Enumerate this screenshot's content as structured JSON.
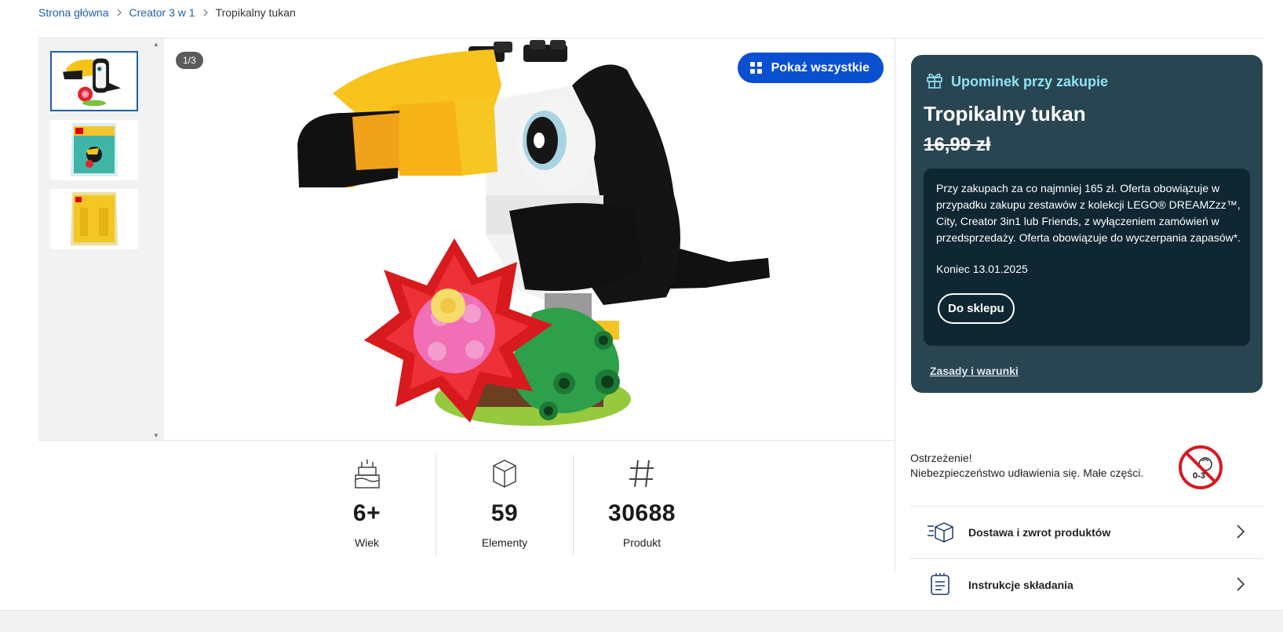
{
  "breadcrumb": {
    "home": "Strona główna",
    "category": "Creator 3 w 1",
    "current": "Tropikalny tukan"
  },
  "gallery": {
    "counter": "1/3",
    "show_all_label": "Pokaż wszystkie",
    "thumbnails": [
      "toucan-model",
      "polybag-front",
      "polybag-back"
    ],
    "selected_index": 0
  },
  "specs": [
    {
      "icon": "birthday-cake-icon",
      "value": "6+",
      "label": "Wiek"
    },
    {
      "icon": "brick-icon",
      "value": "59",
      "label": "Elementy"
    },
    {
      "icon": "hash-icon",
      "value": "30688",
      "label": "Produkt"
    }
  ],
  "promo": {
    "heading": "Upominek przy zakupie",
    "title": "Tropikalny tukan",
    "price": "16,99 zł",
    "description": "Przy zakupach za co najmniej 165 zł. Oferta obowiązuje w przypadku zakupu zestawów z kolekcji LEGO® DREAMZzz™, City, Creator 3in1 lub Friends, z wyłączeniem zamówień w przedsprzedaży. Oferta obowiązuje do wyczerpania zapasów*.",
    "end_date": "Koniec 13.01.2025",
    "button": "Do sklepu",
    "terms": "Zasady i warunki",
    "colors": {
      "card": "#2a4552",
      "inner": "#0f2733",
      "accent": "#8fe3f2"
    }
  },
  "warning": {
    "line1": "Ostrzeżenie!",
    "line2": "Niebezpieczeństwo udławienia się. Małe części.",
    "badge": "0-3"
  },
  "side_links": [
    {
      "icon": "delivery-box-icon",
      "label": "Dostawa i zwrot produktów"
    },
    {
      "icon": "instructions-icon",
      "label": "Instrukcje składania"
    }
  ],
  "accent_color": "#0b4fd1"
}
